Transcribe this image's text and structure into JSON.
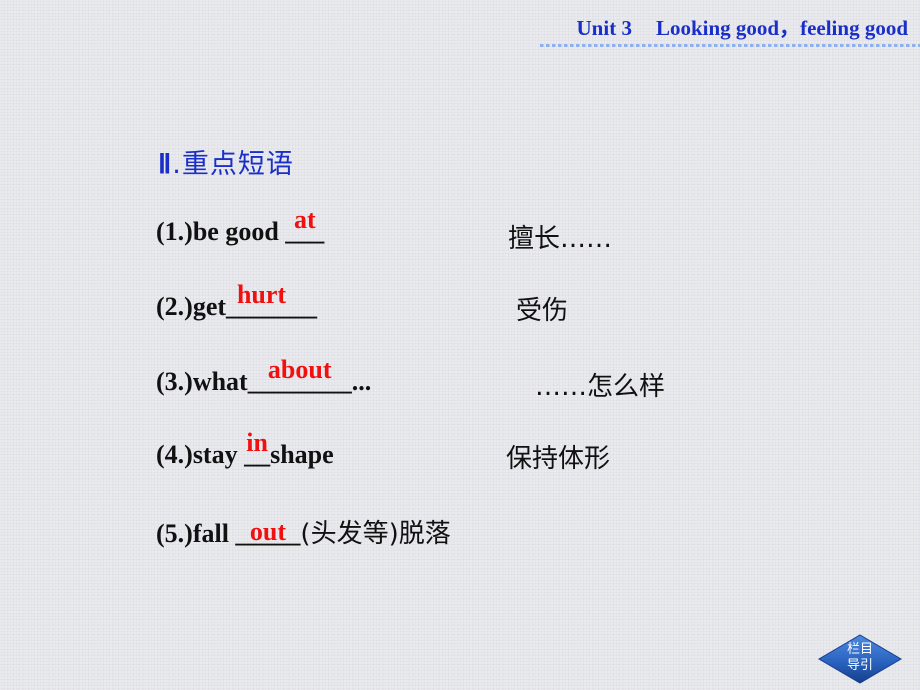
{
  "header": {
    "unit": "Unit 3",
    "title": "Looking good，feeling good"
  },
  "section": {
    "numeral": "Ⅱ",
    "title": ".重点短语"
  },
  "phrases": [
    {
      "prefix": "(1.)be good ",
      "blank": "___",
      "answer": "at",
      "suffix": "",
      "meaning": "擅长……"
    },
    {
      "prefix": "(2.)get",
      "blank": "_______",
      "answer": "hurt",
      "suffix": "",
      "meaning": "受伤"
    },
    {
      "prefix": "(3.)what",
      "blank": "________",
      "answer": "about",
      "suffix": "...",
      "meaning": "……怎么样"
    },
    {
      "prefix": "(4.)stay ",
      "blank": "__",
      "answer": "in",
      "suffix": "shape",
      "meaning": "保持体形"
    },
    {
      "prefix": "(5.)fall ",
      "blank": "_____",
      "answer": "out",
      "suffix": "(头发等)脱落",
      "meaning": ""
    }
  ],
  "nav": {
    "line1": "栏目",
    "line2": "导引"
  },
  "colors": {
    "header_blue": "#1a2fc8",
    "answer_red": "#f01010",
    "nav_blue": "#2a64c0"
  }
}
